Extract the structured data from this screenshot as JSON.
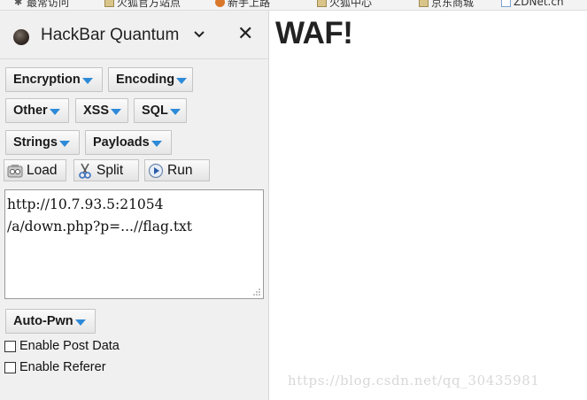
{
  "bookmarks": [
    {
      "label": "最常访问",
      "icon": "gear-icon"
    },
    {
      "label": "火狐官方站点",
      "icon": "folder-icon"
    },
    {
      "label": "新手上路",
      "icon": "firefox-icon"
    },
    {
      "label": "火狐中心",
      "icon": "folder-icon"
    },
    {
      "label": "京东商城",
      "icon": "folder-icon"
    },
    {
      "label": "ZDNet.cn",
      "icon": "page-icon"
    }
  ],
  "sidebar": {
    "title": "HackBar Quantum",
    "close_symbol": "✕",
    "menus": {
      "encryption": "Encryption",
      "encoding": "Encoding",
      "other": "Other",
      "xss": "XSS",
      "sql": "SQL",
      "strings": "Strings",
      "payloads": "Payloads"
    },
    "tools": {
      "load": "Load",
      "split": "Split",
      "run": "Run"
    },
    "url_value": "http://10.7.93.5:21054\n/a/down.php?p=...//flag.txt",
    "autopwn": "Auto-Pwn",
    "enable_post": "Enable Post Data",
    "enable_referer": "Enable Referer"
  },
  "page": {
    "heading": "WAF!",
    "watermark": "https://blog.csdn.net/qq_30435981"
  },
  "colors": {
    "accent_triangle": "#2d8ad8",
    "sidebar_bg": "#f0f0f0"
  }
}
